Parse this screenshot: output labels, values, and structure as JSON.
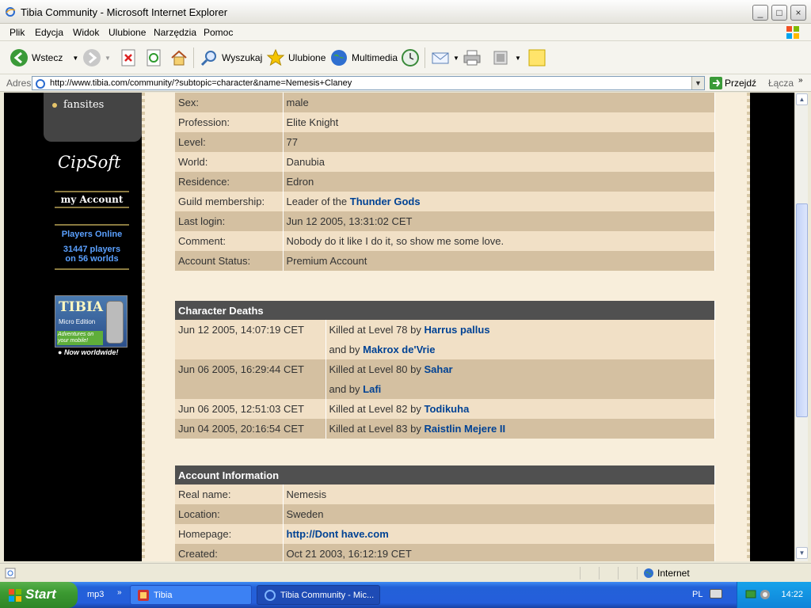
{
  "window": {
    "title": "Tibia Community - Microsoft Internet Explorer",
    "minimize": "_",
    "maximize": "□",
    "close": "×"
  },
  "menu": [
    "Plik",
    "Edycja",
    "Widok",
    "Ulubione",
    "Narzędzia",
    "Pomoc"
  ],
  "toolbar": {
    "back": "Wstecz",
    "search": "Wyszukaj",
    "favorites": "Ulubione",
    "media": "Multimedia"
  },
  "address": {
    "label": "Adres",
    "url": "http://www.tibia.com/community/?subtopic=character&name=Nemesis+Claney",
    "go": "Przejdź",
    "links": "Łącza"
  },
  "nav": {
    "fansites": "fansites",
    "brand": "CipSoft",
    "my_account": "my Account",
    "players_online_title": "Players Online",
    "players_line1": "31447 players",
    "players_line2": "on 56 worlds",
    "banner_title": "TIBIA",
    "banner_sub": "Micro Edition",
    "banner_tag": "Adventures on your mobile!",
    "now_worldwide": "Now worldwide!"
  },
  "character": {
    "rows": [
      {
        "key": "Sex:",
        "value": "male"
      },
      {
        "key": "Profession:",
        "value": "Elite Knight"
      },
      {
        "key": "Level:",
        "value": "77"
      },
      {
        "key": "World:",
        "value": "Danubia"
      },
      {
        "key": "Residence:",
        "value": "Edron"
      },
      {
        "key": "Guild membership:",
        "value": "Leader of the",
        "link": "Thunder Gods"
      },
      {
        "key": "Last login:",
        "value": "Jun 12 2005, 13:31:02 CET"
      },
      {
        "key": "Comment:",
        "value": "Nobody do it like I do it, so show me some love."
      },
      {
        "key": "Account Status:",
        "value": "Premium Account"
      }
    ]
  },
  "deaths": {
    "title": "Character Deaths",
    "rows": [
      {
        "date": "Jun 12 2005, 14:07:19 CET",
        "text": "Killed at Level 78 by",
        "killer": "Harrus pallus"
      },
      {
        "date": "",
        "text": "and by",
        "killer": "Makrox de'Vrie"
      },
      {
        "date": "Jun 06 2005, 16:29:44 CET",
        "text": "Killed at Level 80 by",
        "killer": "Sahar"
      },
      {
        "date": "",
        "text": "and by",
        "killer": "Lafi"
      },
      {
        "date": "Jun 06 2005, 12:51:03 CET",
        "text": "Killed at Level 82 by",
        "killer": "Todikuha"
      },
      {
        "date": "Jun 04 2005, 20:16:54 CET",
        "text": "Killed at Level 83 by",
        "killer": "Raistlin Mejere II"
      }
    ]
  },
  "account": {
    "title": "Account Information",
    "rows": [
      {
        "key": "Real name:",
        "value": "Nemesis"
      },
      {
        "key": "Location:",
        "value": "Sweden"
      },
      {
        "key": "Homepage:",
        "value": "",
        "link": "http://Dont have.com"
      },
      {
        "key": "Created:",
        "value": "Oct 21 2003, 16:12:19 CET"
      }
    ]
  },
  "status": {
    "zone": "Internet"
  },
  "taskbar": {
    "start": "Start",
    "quicklaunch": "mp3",
    "task1": "Tibia",
    "task2": "Tibia Community - Mic...",
    "lang": "PL",
    "clock": "14:22"
  }
}
